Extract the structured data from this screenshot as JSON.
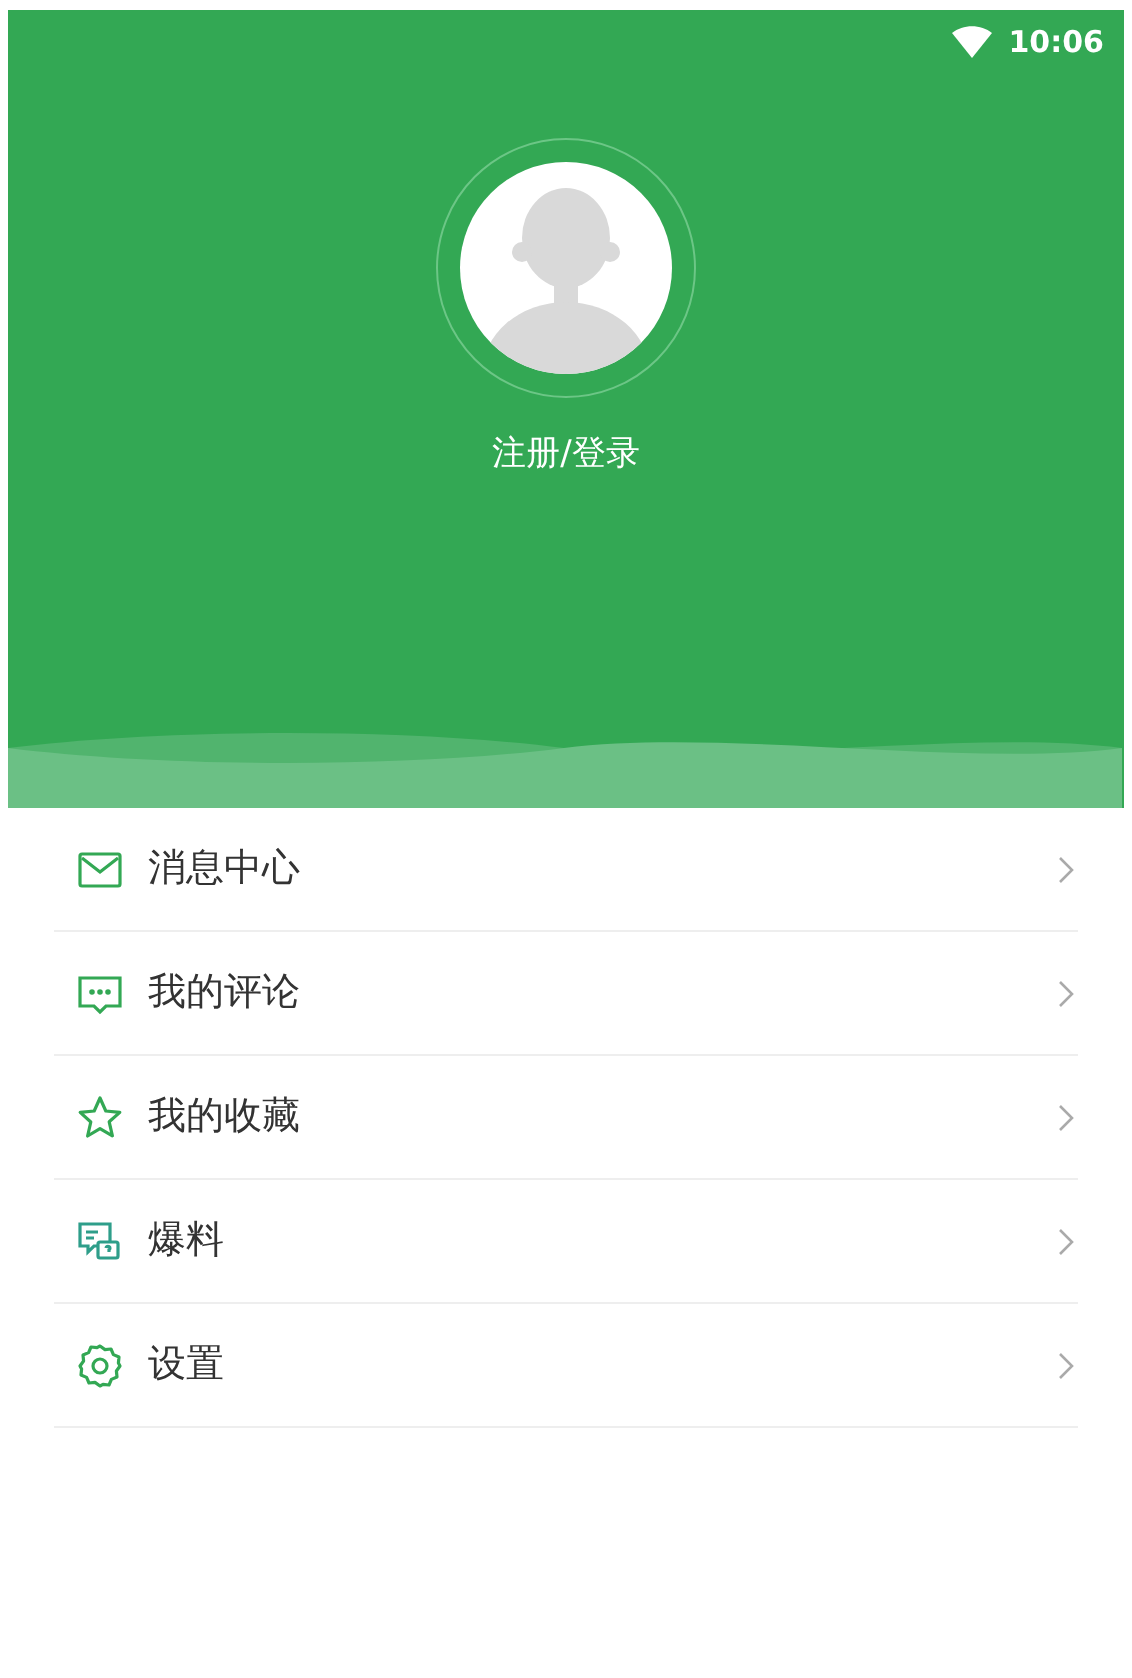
{
  "status_bar": {
    "time": "10:06"
  },
  "profile": {
    "login_label": "注册/登录"
  },
  "menu": [
    {
      "kind": "mail",
      "label": "消息中心"
    },
    {
      "kind": "comment",
      "label": "我的评论"
    },
    {
      "kind": "star",
      "label": "我的收藏"
    },
    {
      "kind": "tipoff",
      "label": "爆料"
    },
    {
      "kind": "settings",
      "label": "设置"
    }
  ]
}
